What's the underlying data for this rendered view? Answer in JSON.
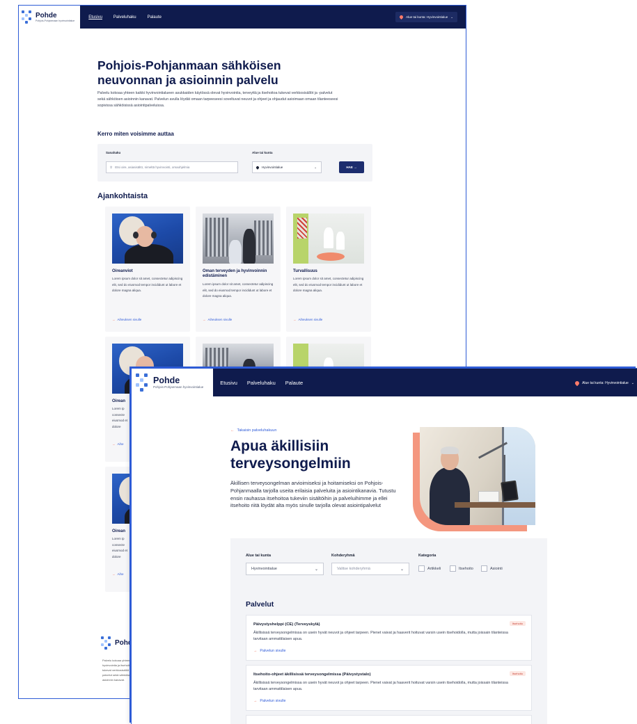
{
  "back_page": {
    "brand": {
      "name": "Pohde",
      "tagline": "Pohjois-Pohjanmaan hyvinvointialue"
    },
    "nav": {
      "links": [
        "Etusivu",
        "Palveluhaku",
        "Palaute"
      ],
      "active": 0
    },
    "region_button": "Alue tai kunta: Hyvinvointialue",
    "hero": {
      "title": "Pohjois-Pohjanmaan sähköisen neuvonnan ja asioinnin palvelu",
      "text": "Palvelu kokoaa yhteen kaikki hyvinvointialueen asukkaiden käytössä olevat hyvinvointia, terveyttä ja itsehoitoa tukevat verkkosisällöt ja -palvelut sekä sähköisen asioinnin kanavat. Palvelun avulla löydät omaan tarpeeseesi soveltuvat neuvot ja ohjeet ja ohjaudut asioimaan omaan tilanteeseesi sopivissa sähköisissä asiointipalveluissa."
    },
    "search": {
      "heading": "Kerro miten voisimme auttaa",
      "query_label": "Sanahaku",
      "query_placeholder": "Etsi oire, asiasisältö, nimeltä hyvinvointi, omaohjelmia",
      "region_label": "Alue tai kunta",
      "region_value": "Hyvinvointialue",
      "button": "HAE"
    },
    "news": {
      "heading": "Ajankohtaista",
      "cards": [
        {
          "title": "Oireanviot",
          "text": "Lorem ipsum dolor sit amet, consectetur adipiscing elit, sed do eiusmod tempor incididunt ut labore et dolore magna aliqua.",
          "link": "Aiheuksen sivulle"
        },
        {
          "title": "Oman terveyden ja hyvinvoinnin edistäminen",
          "text": "Lorem ipsum dolor sit amet, consectetur adipiscing elit, sed do eiusmod tempor incididunt ut labore et dolore magna aliqua.",
          "link": "Aiheuksen sivulle"
        },
        {
          "title": "Turvallisuus",
          "text": "Lorem ipsum dolor sit amet, consectetur adipiscing elit, sed do eiusmod tempor incididunt ut labore et dolore magna aliqua.",
          "link": "Aiheuksen sivulle"
        }
      ],
      "row2_titles": [
        "Oirean",
        "Oirean"
      ],
      "row2_texts": [
        "Lorem ip consecte eiusmod et dolore",
        "Lorem ip consecte eiusmod et dolore"
      ],
      "row2_link": "Aihe"
    },
    "footer": {
      "brand": "Pohde",
      "text": "Palvelu kokoaa yhteen hyvinvointia ja itsehoitoa tukevat verkkosisällöt ja -palvelut sekä sähköisen asioinnin kanavat."
    }
  },
  "front_page": {
    "brand": {
      "name": "Pohde",
      "tagline": "Pohjois-Pohjanmaan hyvinvointialue"
    },
    "nav": {
      "links": [
        "Etusivu",
        "Palveluhaku",
        "Palaute"
      ]
    },
    "region_button": "Alue tai kunta: Hyvinvointialue",
    "back_link": "Takaisin palveluhakuun",
    "title": "Apua äkillisiin terveysongelmiin",
    "intro": "Äkillisen terveysongelman arvioimiseksi ja hoitamiseksi on Pohjois-Pohjanmaalla tarjolla useita erilaisia palveluita ja asiointikanavia. Tutustu ensin rauhassa itsehoitoa tukeviin sisältöihin ja palveluihimme ja ellei itsehoito riitä löydät alta myös sinulle tarjolla olevat asiointipalvelut",
    "filters": {
      "region_label": "Alue tai kunta",
      "region_value": "Hyvinvointialue",
      "group_label": "Kohderyhmä",
      "group_placeholder": "Valitse kohderyhmä",
      "category_label": "Kategoria",
      "categories": [
        "Artikkeli",
        "Itsehoito",
        "Asiointi"
      ]
    },
    "services": {
      "heading": "Palvelut",
      "items": [
        {
          "title": "Päivystyshelppi (CE) (Terveyskylä)",
          "badge": "Itsehoito",
          "desc": "Äkillisissä terveysongelmissa on usein hyvät neuvot ja ohjeet tarpeen. Pienet vaivat ja haaverit hoituvat varsin usein itsehoidolla, mutta joissain tilanteissa tarvitaan ammattilaisen apua.",
          "link": "Palvelun sivulle"
        },
        {
          "title": "Itsehoito-ohjeet äkillisissä terveysongelmissa (Päivystystalo)",
          "badge": "Itsehoito",
          "desc": "Äkillisissä terveysongelmissa on usein hyvät neuvot ja ohjeet tarpeen. Pienet vaivat ja haaverit hoituvat varsin usein itsehoidolla, mutta joissain tilanteissa tarvitaan ammattilaisen apua.",
          "link": "Palvelun sivulle"
        }
      ]
    }
  },
  "icons": [
    "logo-mark-icon",
    "location-pin-icon",
    "search-icon",
    "chevron-down-icon",
    "arrow-right-icon"
  ],
  "colors": {
    "navy": "#0f1b4d",
    "accent": "#f06a55",
    "link": "#2f5bd8",
    "panel": "#f3f4f7"
  }
}
